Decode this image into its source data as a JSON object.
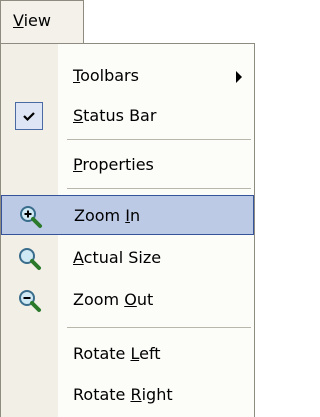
{
  "menu": {
    "title_ul": "V",
    "title_rest": "iew",
    "items": [
      {
        "ul": "T",
        "rest": "oolbars"
      },
      {
        "ul": "S",
        "rest": "tatus Bar"
      },
      {
        "ul": "P",
        "rest": "roperties"
      },
      {
        "pre": "Zoom ",
        "ul": "I",
        "rest": "n"
      },
      {
        "ul": "A",
        "rest": "ctual Size"
      },
      {
        "pre": "Zoom ",
        "ul": "O",
        "rest": "ut"
      },
      {
        "pre": "Rotate ",
        "ul": "L",
        "rest": "eft"
      },
      {
        "pre": "Rotate ",
        "ul": "R",
        "rest": "ight"
      }
    ]
  },
  "colors": {
    "highlight": "#bccae6",
    "highlight_border": "#34539a",
    "gutter": "#f1efe6"
  }
}
